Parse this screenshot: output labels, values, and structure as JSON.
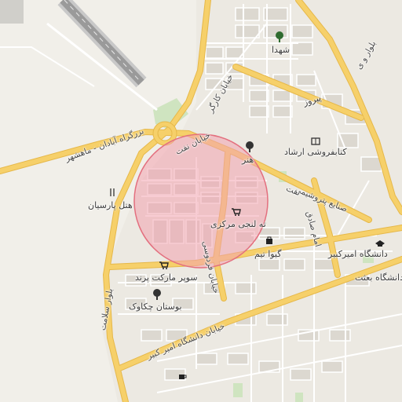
{
  "map": {
    "accent_colors": {
      "background": "#f1efe9",
      "major_road": "#f6d06a",
      "major_road_casing": "#e6b84a",
      "minor_road": "#ffffff",
      "block": "#d9d6cf",
      "park": "#cfe4c0",
      "runway": "#9a9a9a",
      "radius_fill": "#f2a3ae",
      "radius_stroke": "#e3707f"
    },
    "labels": {
      "shohada": "شهدا",
      "bolvar_v": "بلوار و ی",
      "pirouz": "پیروز",
      "khiaban_kargar": "خیابان کارگر",
      "abadan_mahshahr": "بزرگراه آبادان - ماهشهر",
      "khiaban_naft": "خیابان نفت",
      "honar": "هنر",
      "ketabforoushi": "کتابفروشی ارشاد",
      "sanaye_petro": "صنایع پتروشیمی",
      "naft": "نفت",
      "hotel_parsian": "هتل پارسیان",
      "tolanji": "ته لنجی مرکزی",
      "giva_time": "گیوا تیم",
      "daneshgah_amirkabir": "دانشگاه امیرکبیر",
      "bolvar_salamat": "بلوار سلامت",
      "super_market": "سوپر مارکت پرند",
      "boostan_chakavak": "بوستان چکاوک",
      "khiaban_ferdowsi": "خیابان فردوسی",
      "khiaban_daneshgah": "خیابان دانشگاه امیر کبیر",
      "imam_sadegh": "امام صادق",
      "daneshgah_besat": "دانشگاه بعثت"
    },
    "icons": [
      "tree-icon",
      "airport-runway",
      "restaurant-icon",
      "shopping-cart-icon",
      "shopping-bag-icon",
      "book-icon",
      "university-icon",
      "cafe-icon"
    ]
  }
}
